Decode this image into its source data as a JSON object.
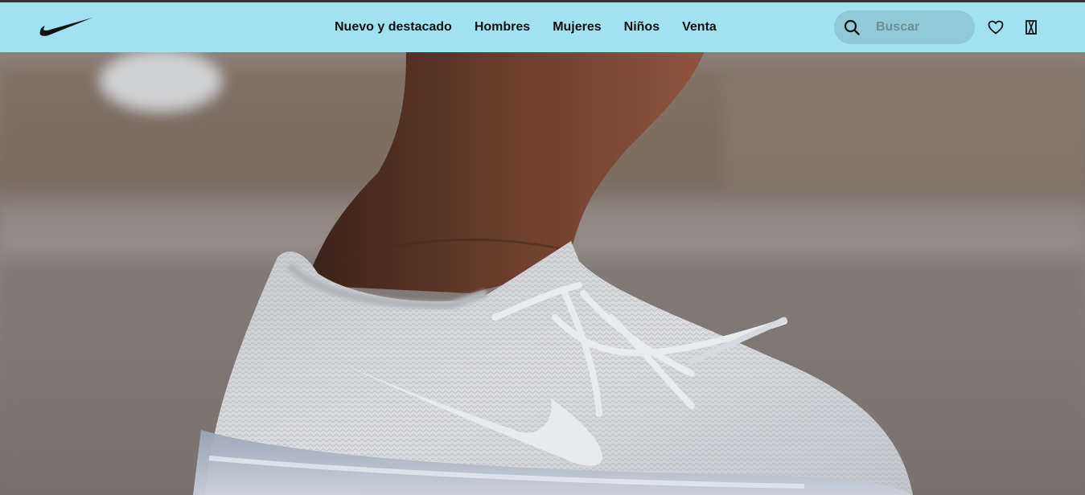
{
  "brand": {
    "logo_icon": "swoosh-logo-icon",
    "nav_background": "#a1e2f0",
    "search_background": "#8fcad6"
  },
  "nav": {
    "items": [
      {
        "label": "Nuevo y destacado"
      },
      {
        "label": "Hombres"
      },
      {
        "label": "Mujeres"
      },
      {
        "label": "Niños"
      },
      {
        "label": "Venta"
      }
    ]
  },
  "search": {
    "placeholder": "Buscar",
    "value": "",
    "icon": "search-icon"
  },
  "actions": {
    "favorites_icon": "heart-icon",
    "bag_icon": "shopping-bag-icon"
  },
  "hero": {
    "media": "hero-shoe-image"
  }
}
